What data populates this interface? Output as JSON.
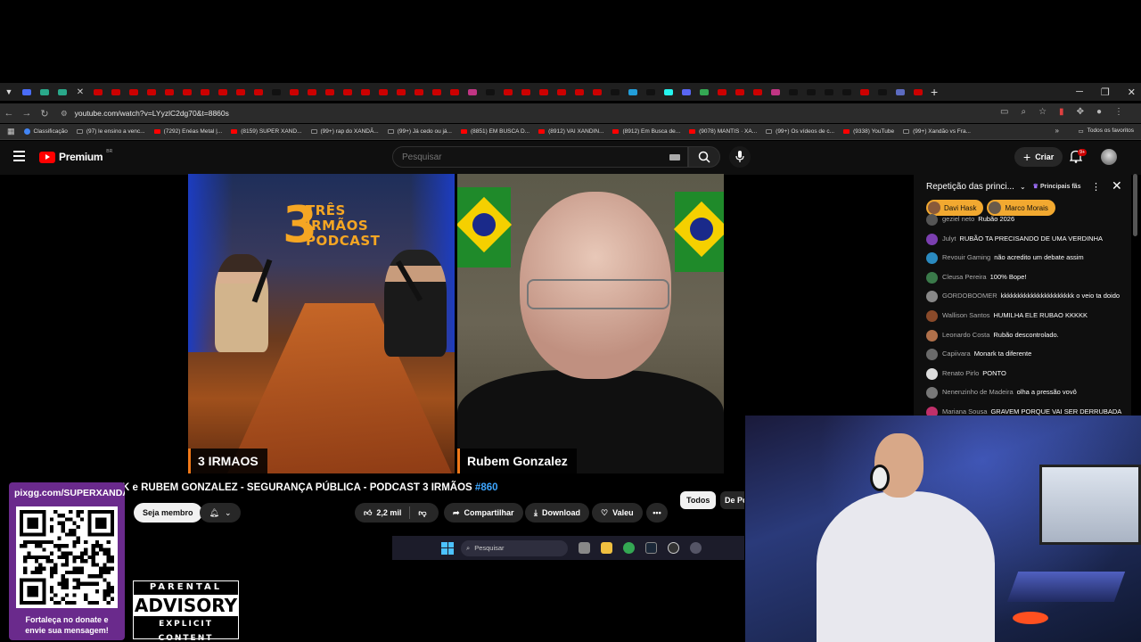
{
  "browser": {
    "url": "youtube.com/watch?v=LYyzlC2dg70&t=8860s",
    "tab_favicon_colors": [
      "#4a6cf7",
      "#2aa88a",
      "#2aa88a",
      "#cc0000",
      "#cc0000",
      "#cc0000",
      "#cc0000",
      "#cc0000",
      "#cc0000",
      "#cc0000",
      "#cc0000",
      "#cc0000",
      "#cc0000",
      "#111111",
      "#cc0000",
      "#cc0000",
      "#cc0000",
      "#cc0000",
      "#cc0000",
      "#cc0000",
      "#cc0000",
      "#cc0000",
      "#cc0000",
      "#cc0000",
      "#c13584",
      "#111111",
      "#cc0000",
      "#cc0000",
      "#cc0000",
      "#cc0000",
      "#cc0000",
      "#cc0000",
      "#111111",
      "#229ed9",
      "#111111",
      "#25f4ee",
      "#5865f2",
      "#34a853",
      "#cc0000",
      "#cc0000",
      "#cc0000",
      "#c13584",
      "#111111",
      "#111111",
      "#111111",
      "#111111",
      "#cc0000",
      "#111111",
      "#5c6bc0",
      "#cc0000"
    ],
    "bookmarks": [
      {
        "label": "Classificação",
        "type": "g"
      },
      {
        "label": "(97) le ensino a venc...",
        "type": "tt"
      },
      {
        "label": "(7292) Enéas Metal |...",
        "type": "yt"
      },
      {
        "label": "(8159) SUPER XAND...",
        "type": "yt"
      },
      {
        "label": "(99+) rap do XANDÃ...",
        "type": "tt"
      },
      {
        "label": "(99+) Já cedo ou já...",
        "type": "tt"
      },
      {
        "label": "(8851) EM BUSCA D...",
        "type": "yt"
      },
      {
        "label": "(8912) VAI XANDIN...",
        "type": "yt"
      },
      {
        "label": "(8912) Em Busca de...",
        "type": "yt"
      },
      {
        "label": "(9078) MANTIS · XA...",
        "type": "yt"
      },
      {
        "label": "(99+) Os vídeos de c...",
        "type": "tt"
      },
      {
        "label": "(9338) YouTube",
        "type": "yt"
      },
      {
        "label": "(99+) Xandão vs Fra...",
        "type": "tt"
      }
    ],
    "all_bookmarks": "Todos os favoritos"
  },
  "youtube": {
    "logo": "Premium",
    "logo_region": "BR",
    "search_placeholder": "Pesquisar",
    "create_label": "Criar",
    "notifications": "9+"
  },
  "video": {
    "left_tag": "3 IRMAOS",
    "right_tag": "Rubem Gonzalez",
    "studio_logo": {
      "number": "3",
      "line1": "TRÊS",
      "line2": "IRMÃOS",
      "line3": "PODCAST"
    },
    "title_prefix": "K e RUBEM GONZALEZ - SEGURANÇA PÚBLICA - PODCAST 3 IRMÃOS",
    "title_episode": "#860",
    "member_label": "Seja membro",
    "likes": "2,2 mil",
    "share_label": "Compartilhar",
    "download_label": "Download",
    "thanks_label": "Valeu",
    "chips": [
      "Todos",
      "De Po"
    ]
  },
  "chat": {
    "title": "Repetição das princi...",
    "fans_label": "Principais fãs",
    "pinned": [
      "Davi Hask",
      "Marco Morais"
    ],
    "messages": [
      {
        "author": "geziel neto",
        "text": "Rubão 2026",
        "color": "#555555"
      },
      {
        "author": "Julyt",
        "text": "RUBÃO TA PRECISANDO DE UMA VERDINHA",
        "color": "#7b3fb0"
      },
      {
        "author": "Revouir Gaming",
        "text": "não acredito um debate assim",
        "color": "#2a8ac0"
      },
      {
        "author": "Cleusa Pereira",
        "text": "100% Bope!",
        "color": "#3a7a4a"
      },
      {
        "author": "GORDOBOOMER",
        "text": "kkkkkkkkkkkkkkkkkkkkkk o veio ta doido",
        "color": "#888888"
      },
      {
        "author": "Wallison Santos",
        "text": "HUMILHA ELE RUBAO KKKKK",
        "color": "#8a4a2a"
      },
      {
        "author": "Leonardo Costa",
        "text": "Rubão descontrolado.",
        "color": "#b0704a"
      },
      {
        "author": "Capiivara",
        "text": "Monark ta diferente",
        "color": "#6a6a6a"
      },
      {
        "author": "Renato Pirlo",
        "text": "PONTO",
        "color": "#dddddd"
      },
      {
        "author": "Nenenzinho de Madeira",
        "text": "olha a pressão vovô",
        "color": "#777777"
      },
      {
        "author": "Mariana Sousa",
        "text": "GRAVEM PORQUE VAI SER DERRUBADA ESSA LIVE",
        "color": "#c0306a"
      }
    ]
  },
  "taskbar": {
    "search_label": "Pesquisar"
  },
  "overlay": {
    "qr_url": "pixgg.com/SUPERXANDAO",
    "qr_caption_1": "Fortaleça no donate e",
    "qr_caption_2": "envie sua mensagem!",
    "advisory_top": "PARENTAL",
    "advisory_mid": "ADVISORY",
    "advisory_bot": "EXPLICIT CONTENT"
  }
}
